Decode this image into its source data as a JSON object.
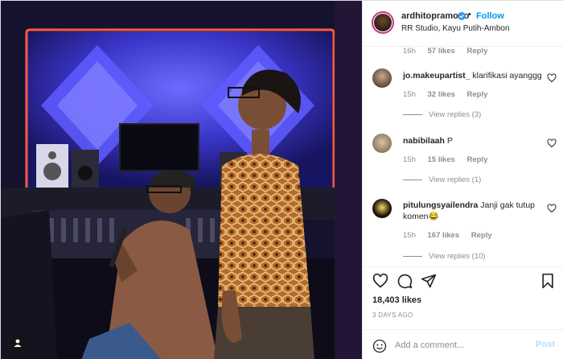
{
  "post": {
    "author": "ardhitopramono",
    "follow_label": "Follow",
    "dot": "•",
    "location": "RR Studio, Kayu Putih-Ambon",
    "more_label": "···"
  },
  "top_meta": {
    "time": "16h",
    "likes": "57 likes",
    "reply": "Reply"
  },
  "comments": [
    {
      "user": "jo.makeupartist_",
      "text": "klarifikasi ayanggg",
      "time": "15h",
      "likes": "32 likes",
      "reply": "Reply",
      "view_replies": "View replies (3)"
    },
    {
      "user": "nabibilaah",
      "text": "P",
      "time": "15h",
      "likes": "15 likes",
      "reply": "Reply",
      "view_replies": "View replies (1)"
    },
    {
      "user": "pitulungsyailendra",
      "text": "Janji gak tutup komen",
      "emoji": "😂",
      "time": "15h",
      "likes": "167 likes",
      "reply": "Reply",
      "view_replies": "View replies (10)"
    }
  ],
  "likes_count": "18,403 likes",
  "posted_ago": "3 DAYS AGO",
  "add_comment": {
    "placeholder": "Add a comment...",
    "post_label": "Post"
  },
  "colors": {
    "accent": "#0095f6",
    "post_disabled": "#b2dffc",
    "neon": "#ff5a3c",
    "wall_blue": "#3a3fd9"
  },
  "icons": [
    "verified-badge-icon",
    "heart-icon",
    "comment-icon",
    "share-icon",
    "bookmark-icon",
    "emoji-icon",
    "user-tag-icon",
    "more-options-icon"
  ]
}
